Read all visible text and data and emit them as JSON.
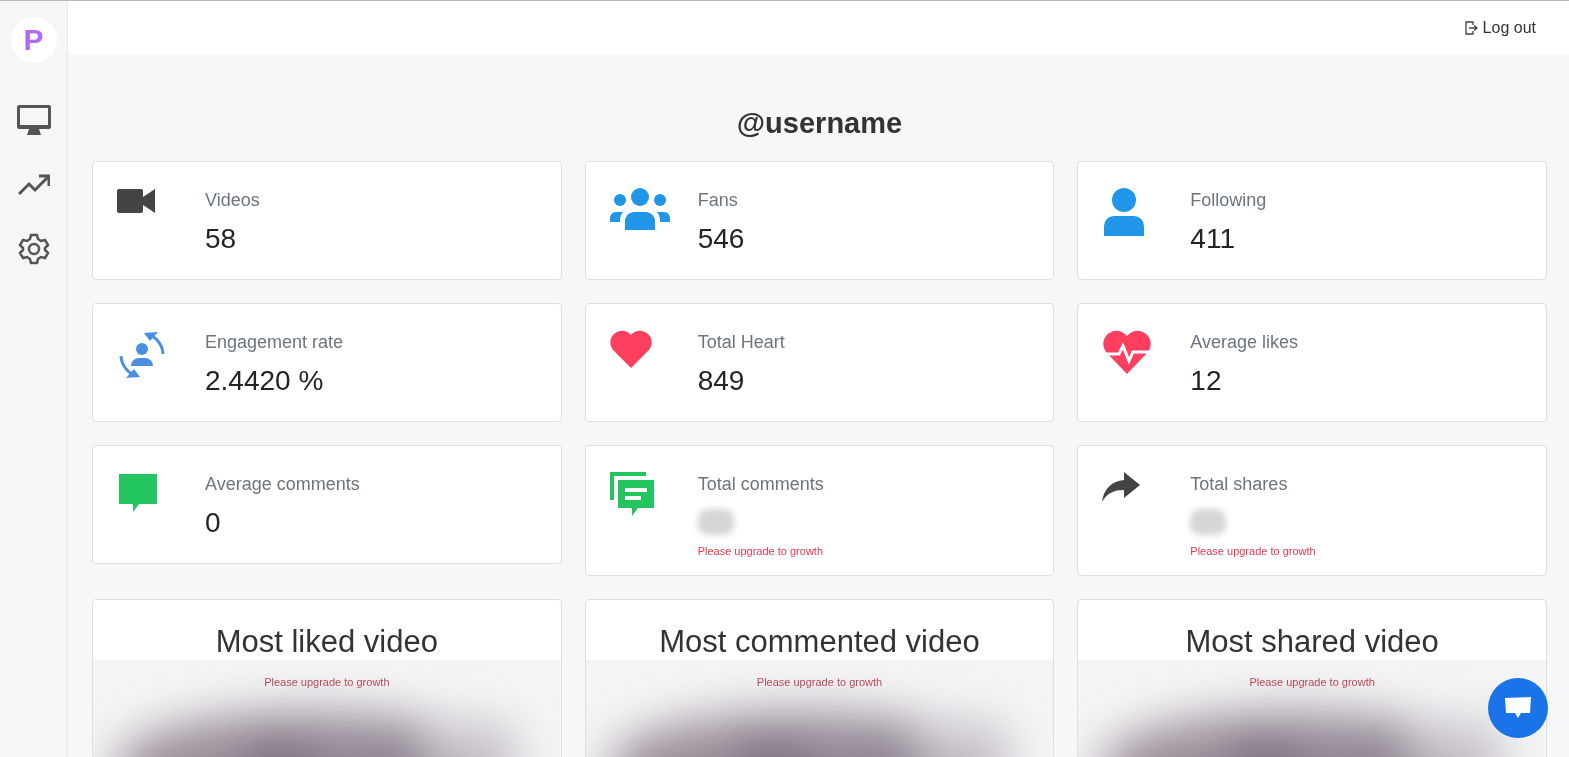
{
  "sidebar": {
    "logo": "P",
    "items": [
      {
        "selected": false
      },
      {
        "selected": false
      },
      {
        "selected": false
      }
    ]
  },
  "top_bar": {
    "logout": "Log out"
  },
  "title": "@username",
  "stats": [
    {
      "label": "Videos",
      "value": "58",
      "blurred": false
    },
    {
      "label": "Fans",
      "value": "546",
      "blurred": false
    },
    {
      "label": "Following",
      "value": "411",
      "blurred": false
    },
    {
      "label": "Engagement rate",
      "value": "2.4420 %",
      "blurred": false
    },
    {
      "label": "Total Heart",
      "value": "849",
      "blurred": false
    },
    {
      "label": "Average likes",
      "value": "12",
      "blurred": false
    },
    {
      "label": "Average comments",
      "value": "0",
      "blurred": false
    },
    {
      "label": "Total comments",
      "blurred": true,
      "note": "Please upgrade to growth"
    },
    {
      "label": "Total shares",
      "blurred": true,
      "note": "Please upgrade to growth"
    }
  ],
  "videos": [
    {
      "title": "Most liked video",
      "note": "Please upgrade to growth",
      "kind": "picture"
    },
    {
      "title": "Most commented video",
      "note": "Please upgrade to growth",
      "kind": "picture"
    },
    {
      "title": "Most shared video",
      "note": "Please upgrade to growth",
      "kind": "picture"
    }
  ]
}
